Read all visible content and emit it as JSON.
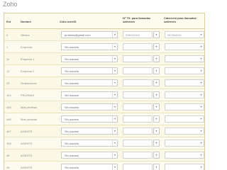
{
  "page": {
    "title": "Zoho"
  },
  "table": {
    "headers": {
      "ext": "Ext",
      "nombre": "Nombre",
      "zoho_userid": "Zoho userID",
      "numero_llamadas": "Nº Tlf. para llamadas salientes",
      "cabecera": "Cabecera para llamadas salientes"
    },
    "rows": [
      {
        "ext": "0",
        "nombre": "Oficina",
        "zoho_user": "pruebas@gmail.com",
        "numero": "928000000",
        "cabecera": "987654321"
      },
      {
        "ext": "1",
        "nombre": "Empresa",
        "zoho_user": "Sin usuario",
        "numero": "",
        "cabecera": ""
      },
      {
        "ext": "11",
        "nombre": "Empresa 1",
        "zoho_user": "Sin usuario",
        "numero": "",
        "cabecera": ""
      },
      {
        "ext": "12",
        "nombre": "Empresa 2",
        "zoho_user": "Sin usuario",
        "numero": "",
        "cabecera": ""
      },
      {
        "ext": "33",
        "nombre": "Grabaciones",
        "zoho_user": "Sin usuario",
        "numero": "",
        "cabecera": ""
      },
      {
        "ext": "444",
        "nombre": "PRUEBAS",
        "zoho_user": "Sin usuario",
        "numero": "",
        "cabecera": ""
      },
      {
        "ext": "445",
        "nombre": "Más pruebas",
        "zoho_user": "Sin usuario",
        "numero": "",
        "cabecera": ""
      },
      {
        "ext": "446",
        "nombre": "Más pruebas",
        "zoho_user": "Sin usuario",
        "numero": "",
        "cabecera": ""
      },
      {
        "ext": "447",
        "nombre": "AGENTE",
        "zoho_user": "Sin usuario",
        "numero": "",
        "cabecera": ""
      },
      {
        "ext": "448",
        "nombre": "AGENTE",
        "zoho_user": "Sin usuario",
        "numero": "",
        "cabecera": ""
      },
      {
        "ext": "48",
        "nombre": "AGENTE",
        "zoho_user": "Sin usuario",
        "numero": "",
        "cabecera": ""
      },
      {
        "ext": "49",
        "nombre": "AGENTE",
        "zoho_user": "Sin usuario",
        "numero": "",
        "cabecera": ""
      }
    ]
  },
  "icons": {
    "dropdown": "chevron-down-icon"
  },
  "colors": {
    "frame_border": "#d9cfa0",
    "frame_bg": "#fdfbee"
  }
}
